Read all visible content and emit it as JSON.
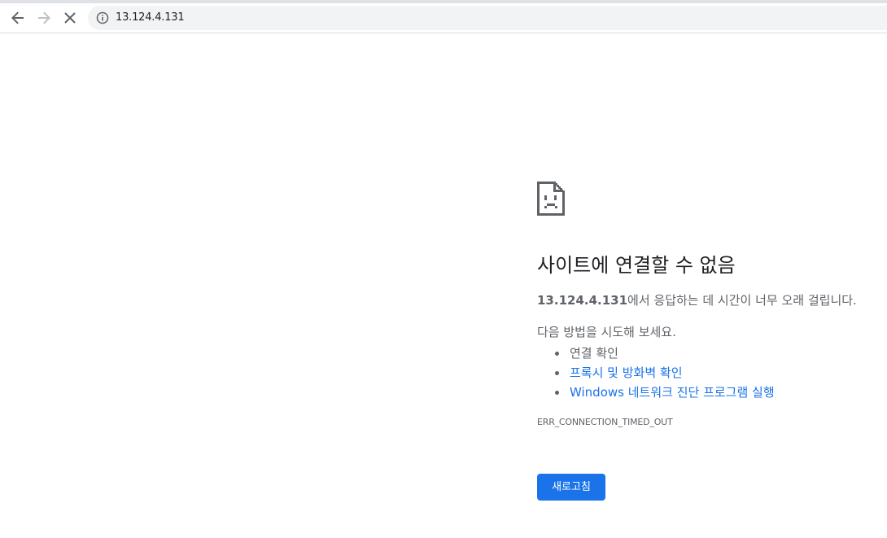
{
  "browser": {
    "url": "13.124.4.131",
    "icons": {
      "back": "back-arrow-icon",
      "forward": "forward-arrow-icon",
      "stop": "stop-loading-icon",
      "site_info": "info-icon"
    }
  },
  "error_page": {
    "icon": "sad-document-icon",
    "headline": "사이트에 연결할 수 없음",
    "summary_host": "13.124.4.131",
    "summary_rest": "에서 응답하는 데 시간이 너무 오래 걸립니다.",
    "suggestions_intro": "다음 방법을 시도해 보세요.",
    "suggestions": [
      {
        "label": "연결 확인",
        "is_link": false
      },
      {
        "label": "프록시 및 방화벽 확인",
        "is_link": true
      },
      {
        "label": "Windows 네트워크 진단 프로그램 실행",
        "is_link": true
      }
    ],
    "error_code": "ERR_CONNECTION_TIMED_OUT",
    "reload_label": "새로고침"
  },
  "colors": {
    "link": "#1a73e8",
    "button_bg": "#1a73e8",
    "secondary_text": "#5f6368",
    "headline_text": "#202124",
    "omnibox_bg": "#f1f3f4"
  }
}
